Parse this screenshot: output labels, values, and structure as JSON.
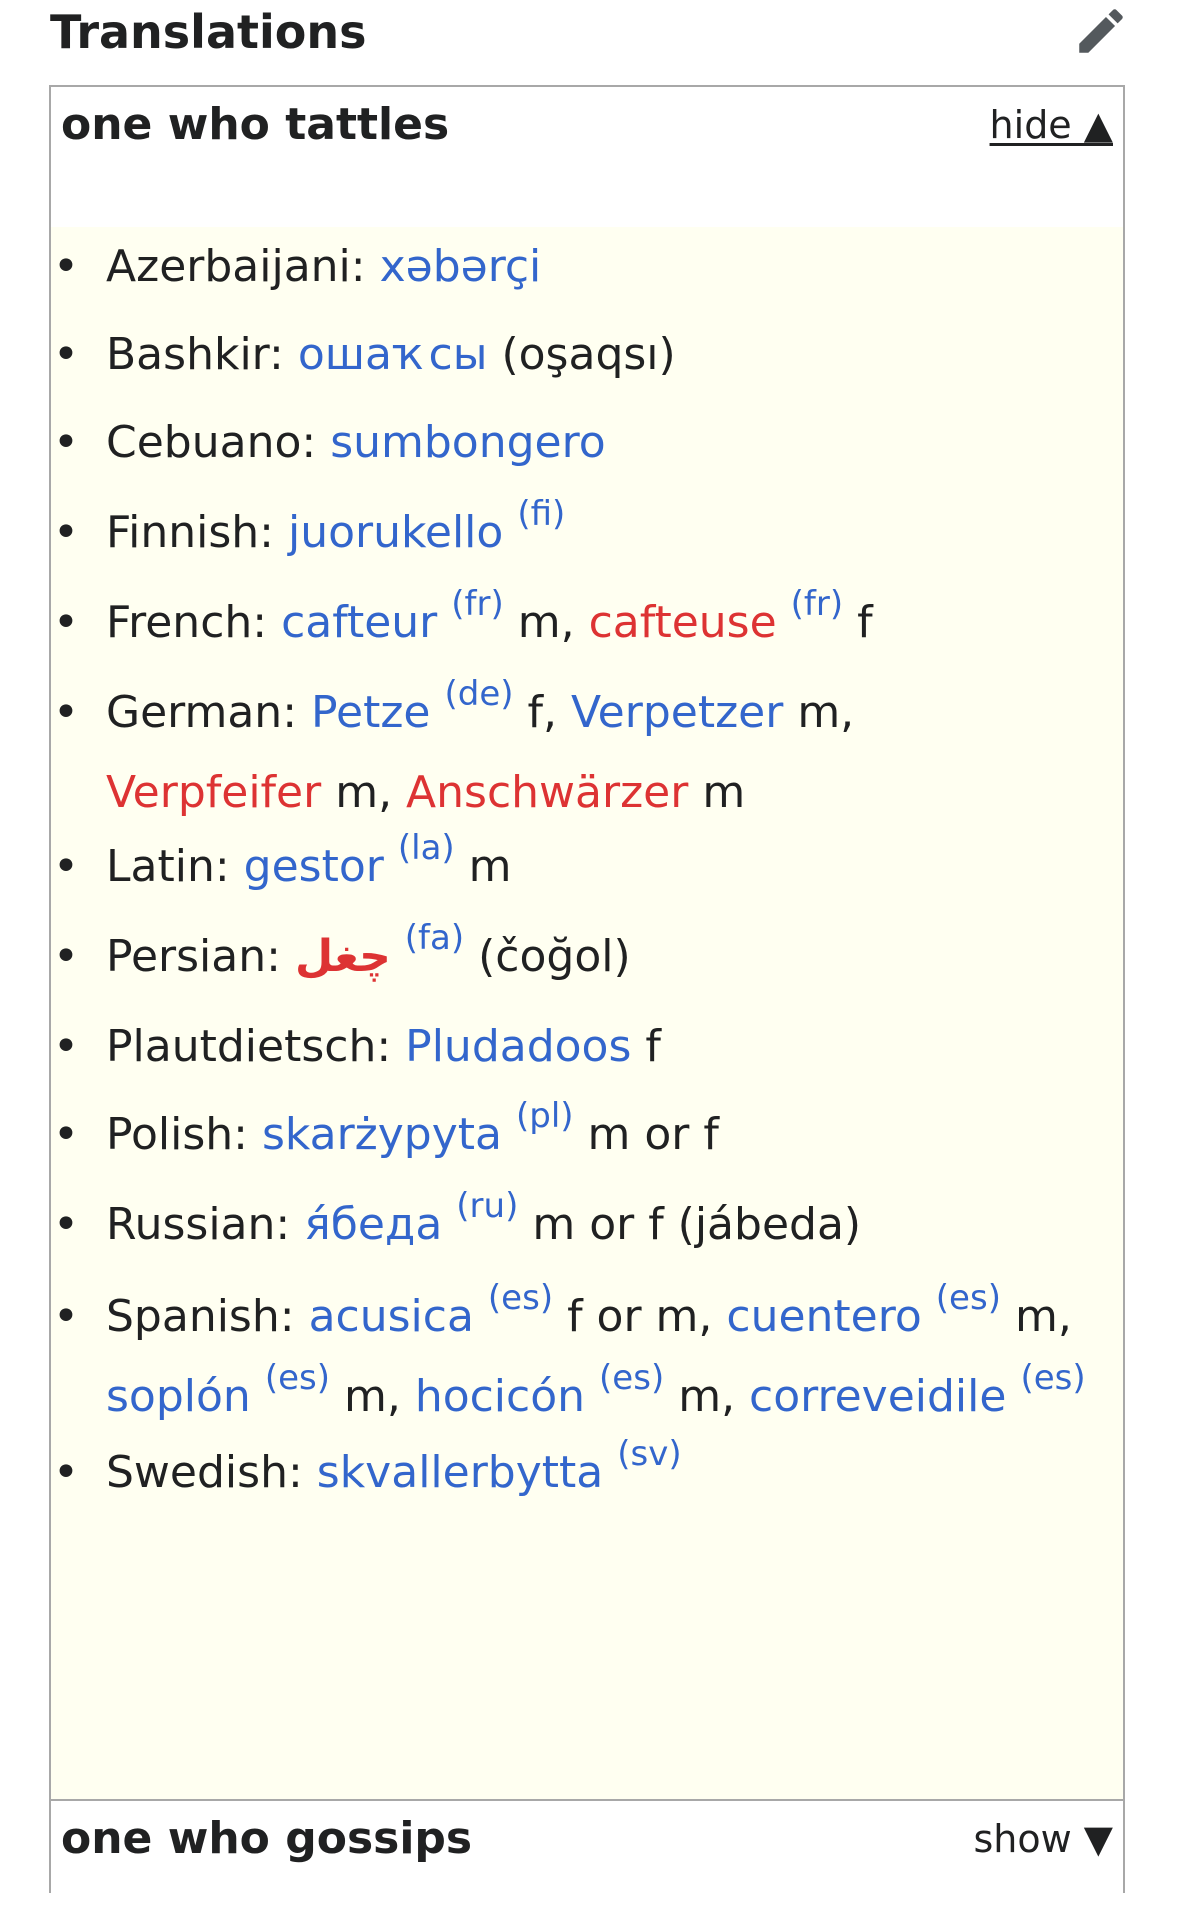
{
  "header": {
    "title": "Translations",
    "edit_icon": "pencil-icon"
  },
  "tattles": {
    "title": "one who tattles",
    "toggle_label": "hide ▲",
    "entries": [
      {
        "lang": "Azerbaijani:",
        "parts": [
          {
            "t": "xəbərçi",
            "c": "blue"
          }
        ]
      },
      {
        "lang": "Bashkir:",
        "parts": [
          {
            "t": "ошаҡсы",
            "c": "blue"
          },
          {
            "t": " (oşaqsı)",
            "c": "plain"
          }
        ]
      },
      {
        "lang": "Cebuano:",
        "parts": [
          {
            "t": "sumbongero",
            "c": "blue"
          }
        ]
      },
      {
        "lang": "Finnish:",
        "parts": [
          {
            "t": "juorukello",
            "c": "blue"
          },
          {
            "t": "(fi)",
            "c": "sup"
          }
        ]
      },
      {
        "lang": "French:",
        "parts": [
          {
            "t": "cafteur",
            "c": "blue"
          },
          {
            "t": "(fr)",
            "c": "sup"
          },
          {
            "t": " m, ",
            "c": "plain"
          },
          {
            "t": "cafteuse",
            "c": "red"
          },
          {
            "t": "(fr)",
            "c": "sup"
          },
          {
            "t": " f",
            "c": "plain"
          }
        ]
      },
      {
        "lang": "German:",
        "parts": [
          {
            "t": "Petze",
            "c": "blue"
          },
          {
            "t": "(de)",
            "c": "sup"
          },
          {
            "t": " f, ",
            "c": "plain"
          },
          {
            "t": "Verpetzer",
            "c": "blue"
          },
          {
            "t": " m,",
            "c": "plain"
          }
        ],
        "line2": [
          {
            "t": "Verpfeifer",
            "c": "red"
          },
          {
            "t": " m, ",
            "c": "plain"
          },
          {
            "t": "Anschwärzer",
            "c": "red"
          },
          {
            "t": " m",
            "c": "plain"
          }
        ]
      },
      {
        "lang": "Latin:",
        "parts": [
          {
            "t": "gestor",
            "c": "blue"
          },
          {
            "t": "(la)",
            "c": "sup"
          },
          {
            "t": " m",
            "c": "plain"
          }
        ]
      },
      {
        "lang": "Persian:",
        "parts": [
          {
            "t": "چغل",
            "c": "redbold"
          },
          {
            "t": "(fa)",
            "c": "sup"
          },
          {
            "t": " (čoğol)",
            "c": "plain"
          }
        ]
      },
      {
        "lang": "Plautdietsch:",
        "parts": [
          {
            "t": "Pludadoos",
            "c": "blue"
          },
          {
            "t": " f",
            "c": "plain"
          }
        ]
      },
      {
        "lang": "Polish:",
        "parts": [
          {
            "t": "skarżypyta",
            "c": "blue"
          },
          {
            "t": "(pl)",
            "c": "sup"
          },
          {
            "t": " m or f",
            "c": "plain"
          }
        ]
      },
      {
        "lang": "Russian:",
        "parts": [
          {
            "t": "я́беда",
            "c": "blue"
          },
          {
            "t": "(ru)",
            "c": "sup"
          },
          {
            "t": " m or f (jábeda)",
            "c": "plain"
          }
        ]
      },
      {
        "lang": "Spanish:",
        "parts": [
          {
            "t": "acusica",
            "c": "blue"
          },
          {
            "t": "(es)",
            "c": "sup"
          },
          {
            "t": " f or m, ",
            "c": "plain"
          },
          {
            "t": "cuentero",
            "c": "blue"
          },
          {
            "t": "(es)",
            "c": "sup"
          },
          {
            "t": " m,",
            "c": "plain"
          }
        ],
        "line2": [
          {
            "t": "soplón",
            "c": "blue"
          },
          {
            "t": "(es)",
            "c": "sup"
          },
          {
            "t": " m, ",
            "c": "plain"
          },
          {
            "t": "hocicón",
            "c": "blue"
          },
          {
            "t": "(es)",
            "c": "sup"
          },
          {
            "t": " m, ",
            "c": "plain"
          },
          {
            "t": "correveidile",
            "c": "blue"
          },
          {
            "t": "(es)",
            "c": "sup"
          }
        ]
      },
      {
        "lang": "Swedish:",
        "parts": [
          {
            "t": "skvallerbytta",
            "c": "blue"
          },
          {
            "t": "(sv)",
            "c": "sup"
          }
        ]
      }
    ]
  },
  "gossips": {
    "title": "one who gossips",
    "toggle_label": "show ▼"
  },
  "colors": {
    "link": "#3366cc",
    "redlink": "#dd3333",
    "content_bg": "#fffff1",
    "border": "#a8a8a8"
  }
}
